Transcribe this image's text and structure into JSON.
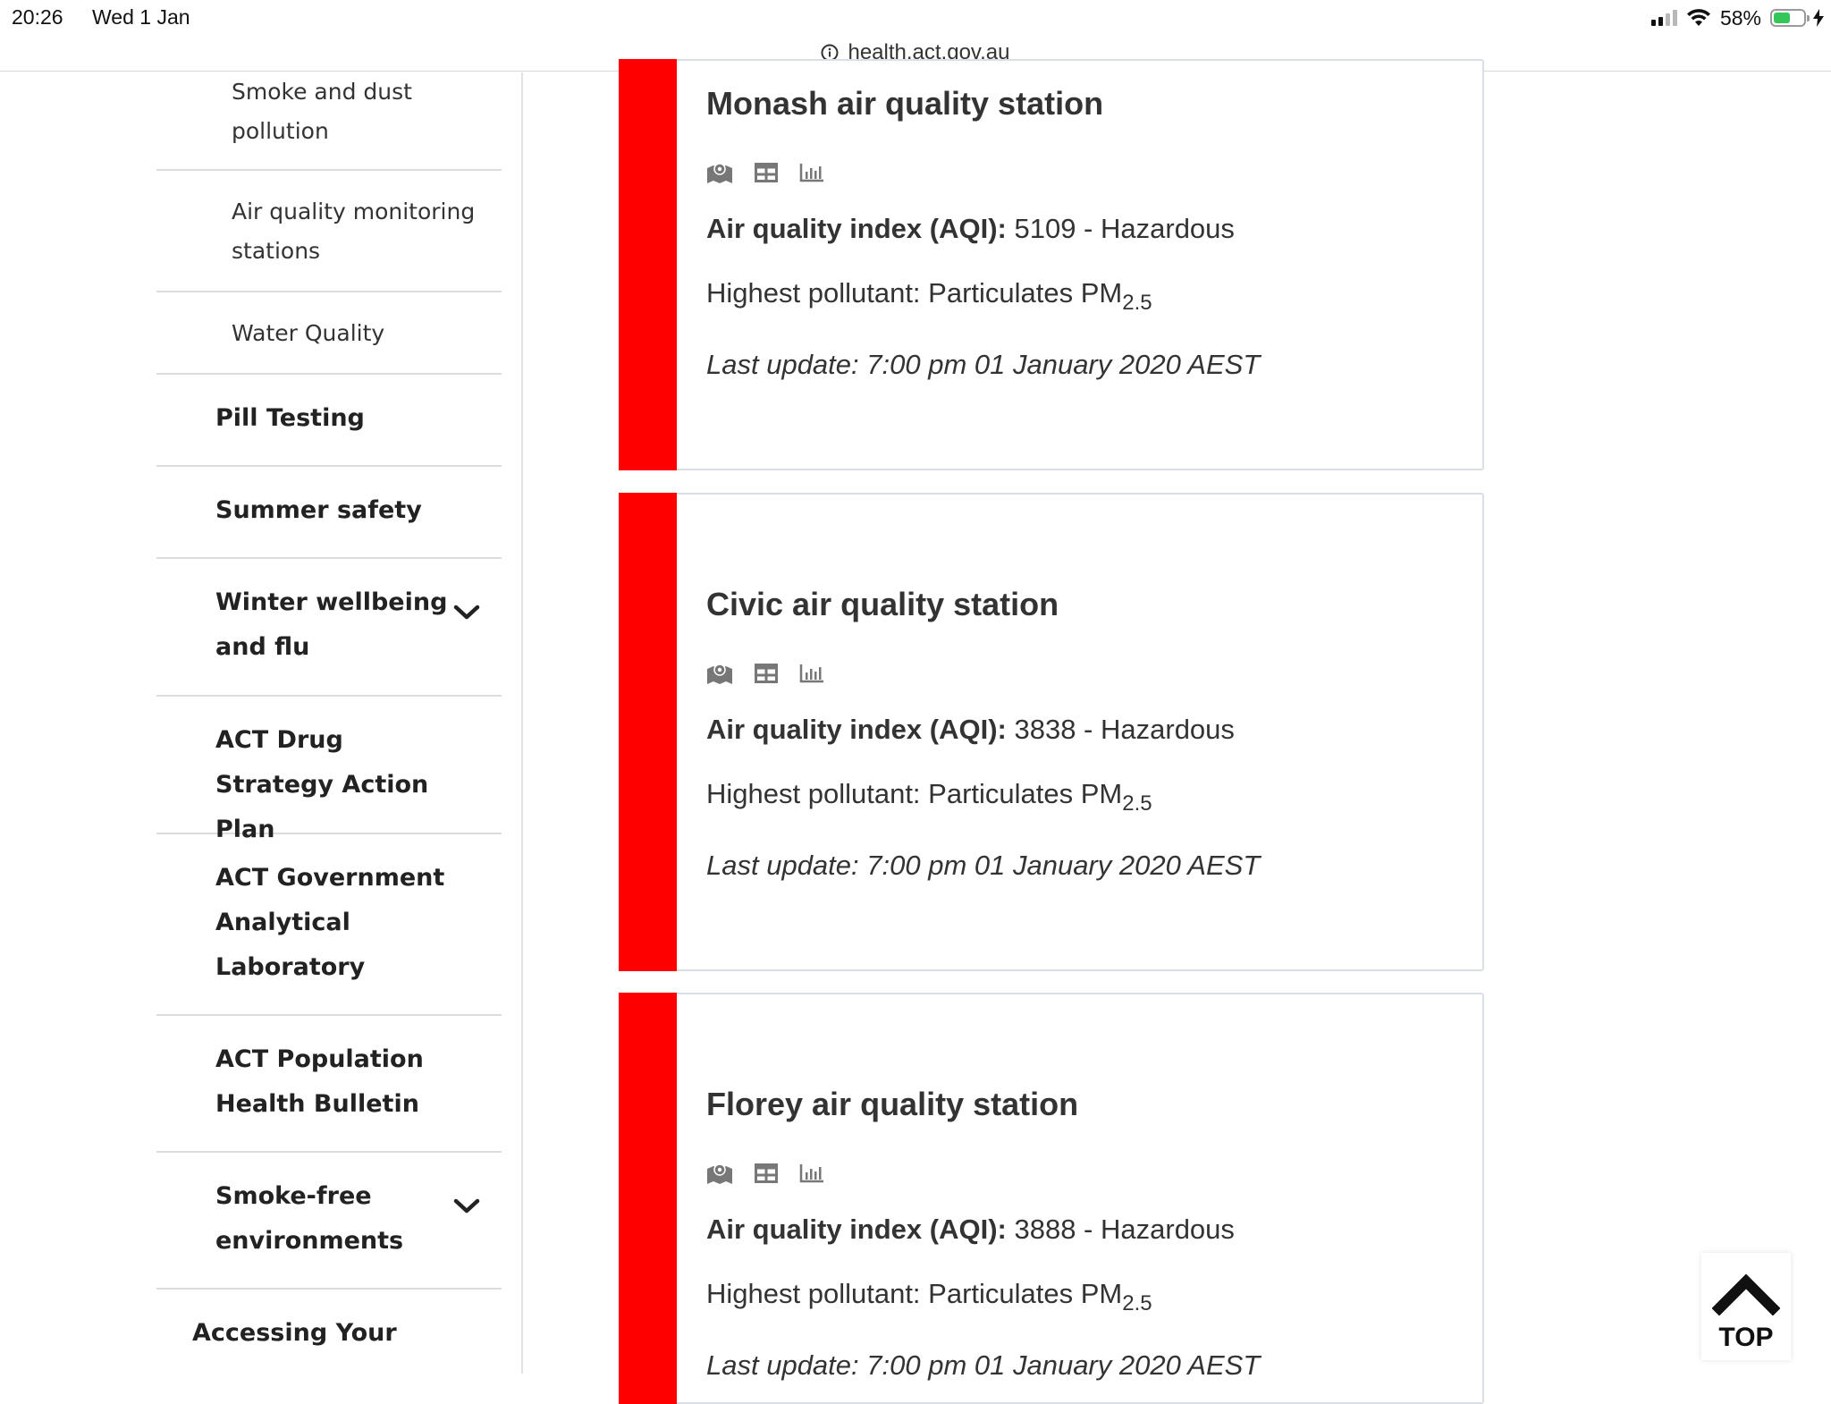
{
  "status_bar": {
    "time": "20:26",
    "date": "Wed 1 Jan",
    "battery_percent": "58%",
    "battery_level": 0.58,
    "signal_bars_filled": 2,
    "charging": true
  },
  "url_bar": {
    "url": "health.act.gov.au",
    "info_icon": "info-circle-icon"
  },
  "sidebar": {
    "items": [
      {
        "label": "Smoke and dust pollution",
        "level": "sub"
      },
      {
        "label": "Air quality monitoring stations",
        "level": "sub"
      },
      {
        "label": "Water Quality",
        "level": "sub"
      },
      {
        "label": "Pill Testing",
        "level": "main"
      },
      {
        "label": "Summer safety",
        "level": "main"
      },
      {
        "label": "Winter wellbeing and flu",
        "level": "main",
        "expandable": true
      },
      {
        "label": "ACT Drug Strategy Action Plan",
        "level": "main"
      },
      {
        "label": "ACT Government Analytical Laboratory",
        "level": "main"
      },
      {
        "label": "ACT Population Health Bulletin",
        "level": "main"
      },
      {
        "label": "Smoke-free environments",
        "level": "main",
        "expandable": true
      },
      {
        "label": "Accessing Your",
        "level": "outer"
      }
    ]
  },
  "stations": [
    {
      "name": "Monash air quality station",
      "aqi_label": "Air quality index (AQI):",
      "aqi_value": "5109 - Hazardous",
      "pollutant_prefix": "Highest pollutant: Particulates PM",
      "pollutant_sub": "2.5",
      "last_update": "Last update: 7:00 pm 01 January 2020 AEST",
      "status_color": "#ff0000",
      "icons": [
        "map-icon",
        "table-icon",
        "chart-icon"
      ]
    },
    {
      "name": "Civic air quality station",
      "aqi_label": "Air quality index (AQI):",
      "aqi_value": "3838 - Hazardous",
      "pollutant_prefix": "Highest pollutant: Particulates PM",
      "pollutant_sub": "2.5",
      "last_update": "Last update: 7:00 pm 01 January 2020 AEST",
      "status_color": "#ff0000",
      "icons": [
        "map-icon",
        "table-icon",
        "chart-icon"
      ]
    },
    {
      "name": "Florey air quality station",
      "aqi_label": "Air quality index (AQI):",
      "aqi_value": "3888 - Hazardous",
      "pollutant_prefix": "Highest pollutant: Particulates PM",
      "pollutant_sub": "2.5",
      "last_update": "Last update: 7:00 pm 01 January 2020 AEST",
      "status_color": "#ff0000",
      "icons": [
        "map-icon",
        "table-icon",
        "chart-icon"
      ]
    }
  ],
  "top_button": {
    "label": "TOP",
    "icon": "chevron-up-icon"
  }
}
